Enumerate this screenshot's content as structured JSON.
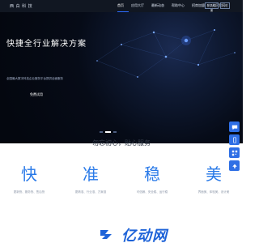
{
  "header": {
    "logo": "西 白 科 技",
    "nav": [
      {
        "label": "首页",
        "active": true
      },
      {
        "label": "应用大厅",
        "active": false
      },
      {
        "label": "最新动态",
        "active": false
      },
      {
        "label": "帮助中心",
        "active": false
      },
      {
        "label": "招商加盟",
        "active": false
      },
      {
        "label": "关于我们",
        "active": false
      }
    ],
    "login_label": "登录/注册",
    "register_label": "入驻"
  },
  "hero": {
    "title": "快捷全行业解决方案",
    "subtitle": "全国最大数字科技企业服务平台提供全面服务",
    "button_label": "免费试用",
    "slides": 3,
    "active_slide": 1
  },
  "features": {
    "title": "勿忘初心，贴心服务",
    "items": [
      {
        "char": "快",
        "desc": "更新快、服务快、售后快"
      },
      {
        "char": "准",
        "desc": "更精准、行业准、方案准"
      },
      {
        "char": "稳",
        "desc": "可信赖、安全稳、运行稳"
      },
      {
        "char": "美",
        "desc": "界面美、体验美、设计美"
      }
    ]
  },
  "sidebar": {
    "items": [
      {
        "icon": "chat-icon"
      },
      {
        "icon": "phone-icon"
      },
      {
        "icon": "qrcode-icon"
      },
      {
        "icon": "arrow-up-icon"
      }
    ]
  },
  "brand": {
    "text": "亿动网"
  },
  "colors": {
    "accent": "#2a7ae8",
    "header_bg": "#111722",
    "hero_bg": "#060b17",
    "brand": "#1e63d8"
  }
}
